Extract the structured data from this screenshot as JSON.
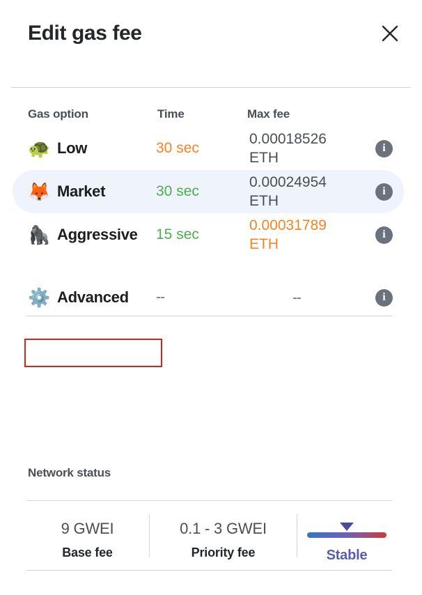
{
  "header": {
    "title": "Edit gas fee",
    "close_icon": "close-icon"
  },
  "table": {
    "columns": {
      "option": "Gas option",
      "time": "Time",
      "fee": "Max fee"
    },
    "rows": [
      {
        "emoji": "🐢",
        "emoji_name": "turtle-emoji",
        "label": "Low",
        "time": "30 sec",
        "fee_amount": "0.00018526",
        "fee_unit": "ETH",
        "selected": false
      },
      {
        "emoji": "🦊",
        "emoji_name": "fox-emoji",
        "label": "Market",
        "time": "30 sec",
        "fee_amount": "0.00024954",
        "fee_unit": "ETH",
        "selected": true
      },
      {
        "emoji": "🦍",
        "emoji_name": "gorilla-emoji",
        "label": "Aggressive",
        "time": "15 sec",
        "fee_amount": "0.00031789",
        "fee_unit": "ETH",
        "selected": false
      }
    ],
    "advanced": {
      "emoji": "⚙️",
      "emoji_name": "gear-emoji",
      "label": "Advanced",
      "time": "--",
      "fee": "--"
    },
    "info_icon": "info-icon"
  },
  "network_status": {
    "title": "Network status",
    "base_fee_value": "9 GWEI",
    "base_fee_label": "Base fee",
    "priority_fee_value": "0.1 - 3 GWEI",
    "priority_fee_label": "Priority fee",
    "stability_label": "Stable"
  },
  "colors": {
    "accent_orange": "#f5841f",
    "accent_green": "#4cae4c",
    "selected_row_bg": "#eff3fb",
    "focus_outline": "#d62416",
    "stable_purple": "#5b5bb0",
    "gauge_start": "#3b73c4",
    "gauge_end": "#d0393e"
  }
}
